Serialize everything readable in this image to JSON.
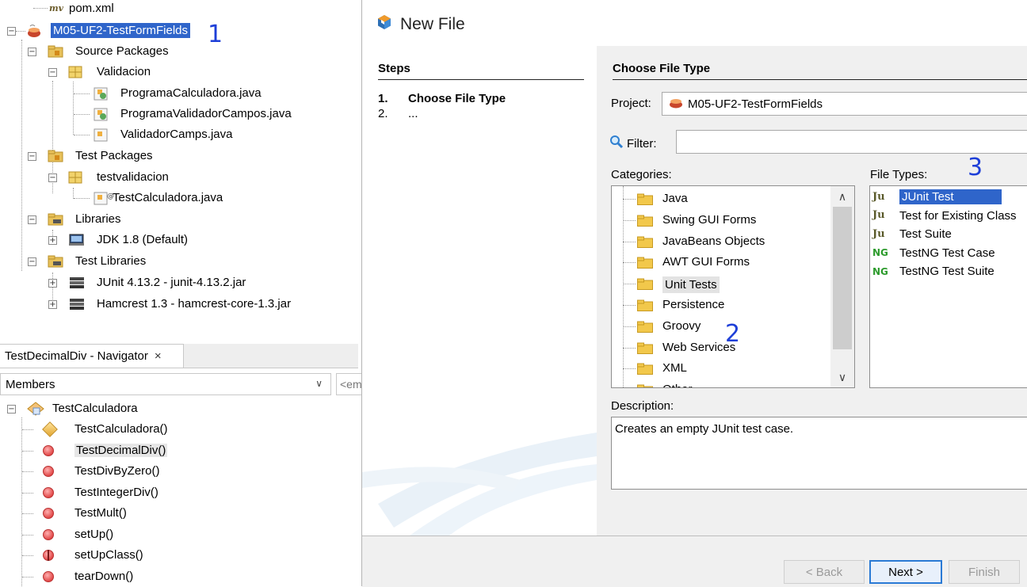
{
  "project_tree": {
    "pom": "pom.xml",
    "project": "M05-UF2-TestFormFields",
    "source_packages": "Source Packages",
    "validacion": "Validacion",
    "files": [
      "ProgramaCalculadora.java",
      "ProgramaValidadorCampos.java",
      "ValidadorCamps.java"
    ],
    "test_packages": "Test Packages",
    "testvalidacion": "testvalidacion",
    "test_file": "TestCalculadora.java",
    "libraries": "Libraries",
    "jdk": "JDK 1.8 (Default)",
    "test_libraries": "Test Libraries",
    "junit_jar": "JUnit 4.13.2 - junit-4.13.2.jar",
    "hamcrest_jar": "Hamcrest 1.3 - hamcrest-core-1.3.jar"
  },
  "navigator": {
    "tab_label": "TestDecimalDiv - Navigator",
    "close": "×",
    "members_label": "Members",
    "filter_placeholder": "<em",
    "class_name": "TestCalculadora",
    "members": [
      {
        "name": "TestCalculadora()",
        "kind": "constructor"
      },
      {
        "name": "TestDecimalDiv()",
        "kind": "method",
        "selected": true
      },
      {
        "name": "TestDivByZero()",
        "kind": "method"
      },
      {
        "name": "TestIntegerDiv()",
        "kind": "method"
      },
      {
        "name": "TestMult()",
        "kind": "method"
      },
      {
        "name": "setUp()",
        "kind": "method"
      },
      {
        "name": "setUpClass()",
        "kind": "static-method"
      },
      {
        "name": "tearDown()",
        "kind": "method"
      }
    ]
  },
  "dialog": {
    "title": "New File",
    "steps_heading": "Steps",
    "steps": [
      {
        "num": "1.",
        "label": "Choose File Type",
        "current": true
      },
      {
        "num": "2.",
        "label": "..."
      }
    ],
    "content_heading": "Choose File Type",
    "project_label": "Project:",
    "project_value": "M05-UF2-TestFormFields",
    "filter_label": "Filter:",
    "categories_label": "Categories:",
    "categories": [
      "Java",
      "Swing GUI Forms",
      "JavaBeans Objects",
      "AWT GUI Forms",
      "Unit Tests",
      "Persistence",
      "Groovy",
      "Web Services",
      "XML",
      "Other"
    ],
    "highlighted_category": "Unit Tests",
    "filetypes_label": "File Types:",
    "filetypes": [
      {
        "icon": "Ju",
        "label": "JUnit Test",
        "selected": true
      },
      {
        "icon": "Ju",
        "label": "Test for Existing Class"
      },
      {
        "icon": "Ju",
        "label": "Test Suite"
      },
      {
        "icon": "NG",
        "label": "TestNG Test Case"
      },
      {
        "icon": "NG",
        "label": "TestNG Test Suite"
      }
    ],
    "description_label": "Description:",
    "description": "Creates an empty JUnit test case.",
    "buttons": {
      "back": "< Back",
      "next": "Next >",
      "finish": "Finish"
    }
  },
  "annotations": [
    "1",
    "2",
    "3"
  ],
  "colors": {
    "selection": "#2f65ca",
    "annotation": "#1e3fd8"
  }
}
